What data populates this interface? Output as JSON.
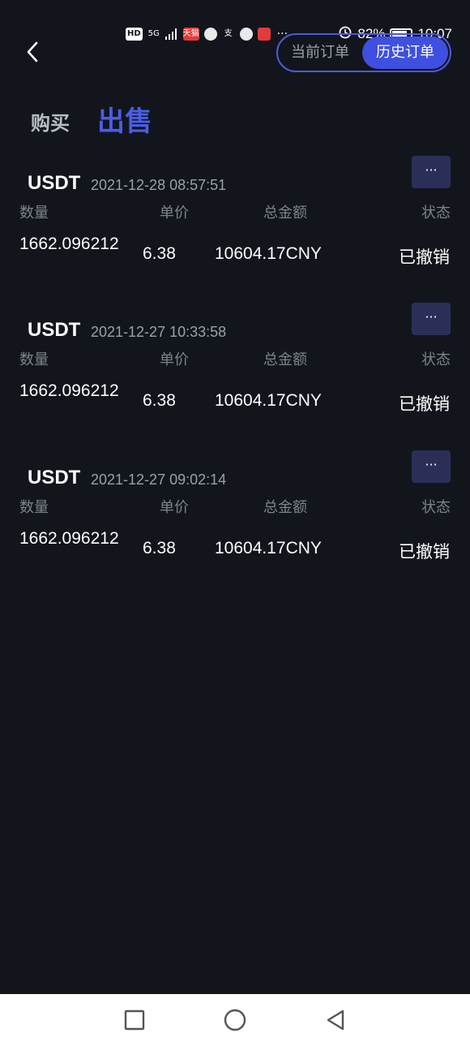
{
  "status_bar": {
    "left_icons": [
      "HD",
      "5G",
      "signal",
      "天猫",
      "app",
      "支",
      "hand",
      "book"
    ],
    "more": "···",
    "battery": "82%",
    "time": "10:07"
  },
  "header": {
    "back_icon": "chevron-left-icon",
    "toggle": {
      "current_orders": "当前订单",
      "history_orders": "历史订单"
    }
  },
  "tabs": {
    "buy": "购买",
    "sell": "出售"
  },
  "columns": {
    "quantity": "数量",
    "price": "单价",
    "total": "总金额",
    "status": "状态"
  },
  "orders": [
    {
      "coin": "USDT",
      "time": "2021-12-28 08:57:51",
      "more": "···",
      "quantity": "1662.096212",
      "price": "6.38",
      "total": "10604.17CNY",
      "status": "已撤销"
    },
    {
      "coin": "USDT",
      "time": "2021-12-27 10:33:58",
      "more": "···",
      "quantity": "1662.096212",
      "price": "6.38",
      "total": "10604.17CNY",
      "status": "已撤销"
    },
    {
      "coin": "USDT",
      "time": "2021-12-27 09:02:14",
      "more": "···",
      "quantity": "1662.096212",
      "price": "6.38",
      "total": "10604.17CNY",
      "status": "已撤销"
    }
  ],
  "colors": {
    "background": "#12151c",
    "accent": "#4a5de8",
    "muted": "#7d828c"
  },
  "navbar": [
    "square-icon",
    "circle-icon",
    "triangle-back-icon"
  ]
}
